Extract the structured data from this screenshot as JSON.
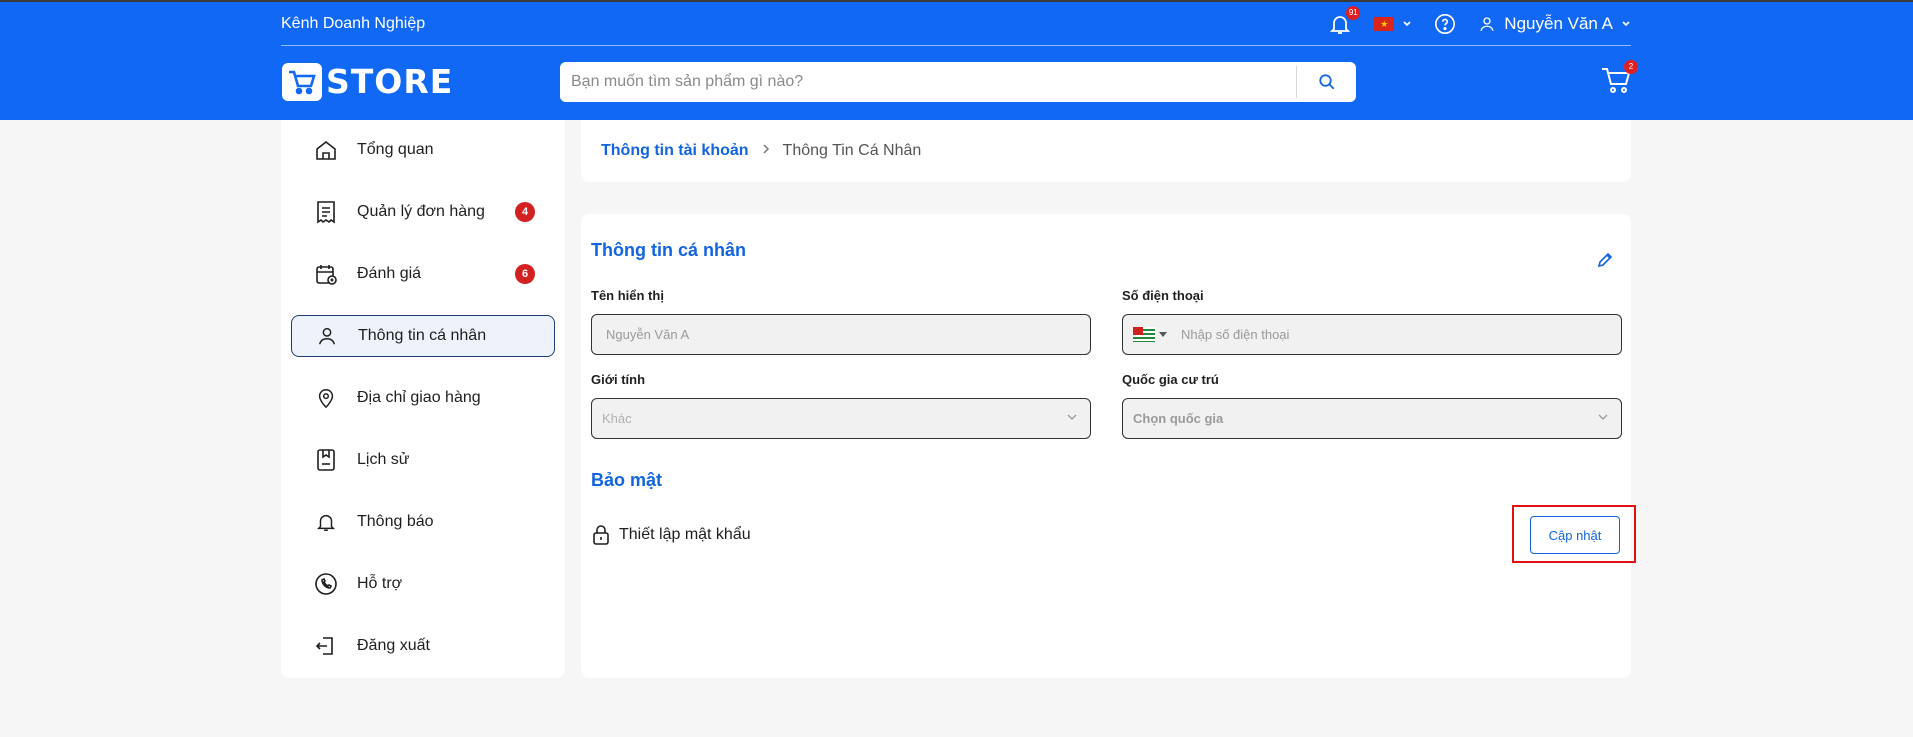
{
  "header": {
    "channel": "Kênh Doanh Nghiệp",
    "notification_count": "91",
    "user_name": "Nguyễn Văn A",
    "logo_text": "STORE",
    "search_placeholder": "Bạn muốn tìm sản phẩm gì nào?",
    "cart_count": "2",
    "brand_color": "#1068f5"
  },
  "sidebar": {
    "items": [
      {
        "label": "Tổng quan",
        "icon": "home-icon"
      },
      {
        "label": "Quản lý đơn hàng",
        "icon": "receipt-icon",
        "badge": "4"
      },
      {
        "label": "Đánh giá",
        "icon": "calendar-review-icon",
        "badge": "6"
      },
      {
        "label": "Thông tin cá nhân",
        "icon": "user-icon",
        "active": true
      },
      {
        "label": "Địa chỉ giao hàng",
        "icon": "location-pin-icon"
      },
      {
        "label": "Lịch sử",
        "icon": "history-icon"
      },
      {
        "label": "Thông báo",
        "icon": "bell-icon"
      },
      {
        "label": "Hỗ trợ",
        "icon": "phone-support-icon"
      },
      {
        "label": "Đăng xuất",
        "icon": "logout-icon"
      }
    ]
  },
  "breadcrumb": {
    "parent": "Thông tin tài khoản",
    "current": "Thông Tin Cá Nhân"
  },
  "profile": {
    "title": "Thông tin cá nhân",
    "display_name_label": "Tên hiển thị",
    "display_name_placeholder": "Nguyễn Văn A",
    "phone_label": "Số điện thoại",
    "phone_placeholder": "Nhập số điện thoại",
    "gender_label": "Giới tính",
    "gender_value": "Khác",
    "country_label": "Quốc gia cư trú",
    "country_value": "Chọn quốc gia"
  },
  "security": {
    "title": "Bảo mật",
    "password_label": "Thiết lập mật khẩu",
    "update_button": "Cập nhật"
  }
}
